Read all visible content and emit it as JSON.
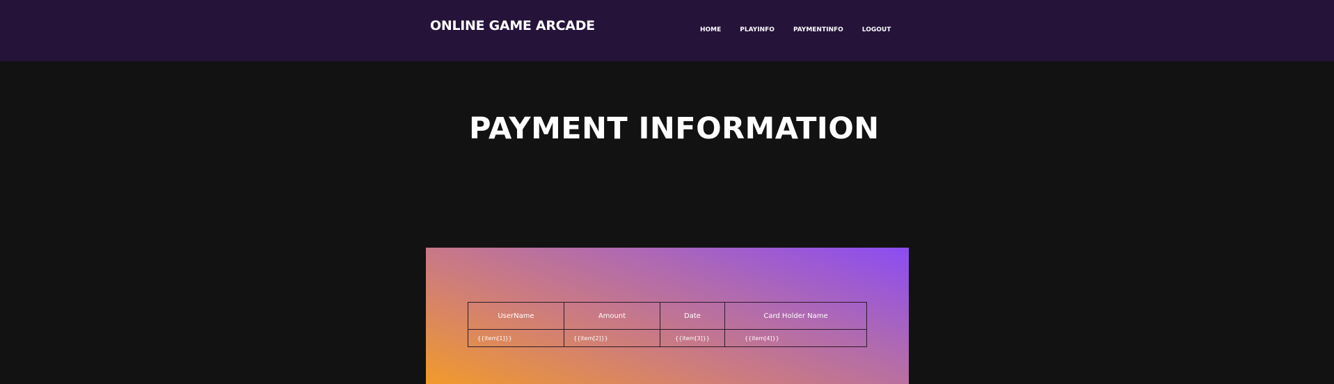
{
  "header": {
    "brand": "ONLINE GAME ARCADE",
    "nav": [
      {
        "label": "HOME"
      },
      {
        "label": "PLAYINFO"
      },
      {
        "label": "PAYMENTINFO"
      },
      {
        "label": "LOGOUT"
      }
    ],
    "background": "#25133a"
  },
  "main": {
    "title": "PAYMENT INFORMATION",
    "table": {
      "columns": [
        "UserName",
        "Amount",
        "Date",
        "Card Holder Name"
      ],
      "rows": [
        [
          "{{item[1]}}",
          "{{item[2]}}",
          "{{item[3]}}",
          "{{item[4]}}"
        ]
      ]
    },
    "panel_gradient": [
      "#8b4cf3",
      "#f19a2c"
    ]
  }
}
